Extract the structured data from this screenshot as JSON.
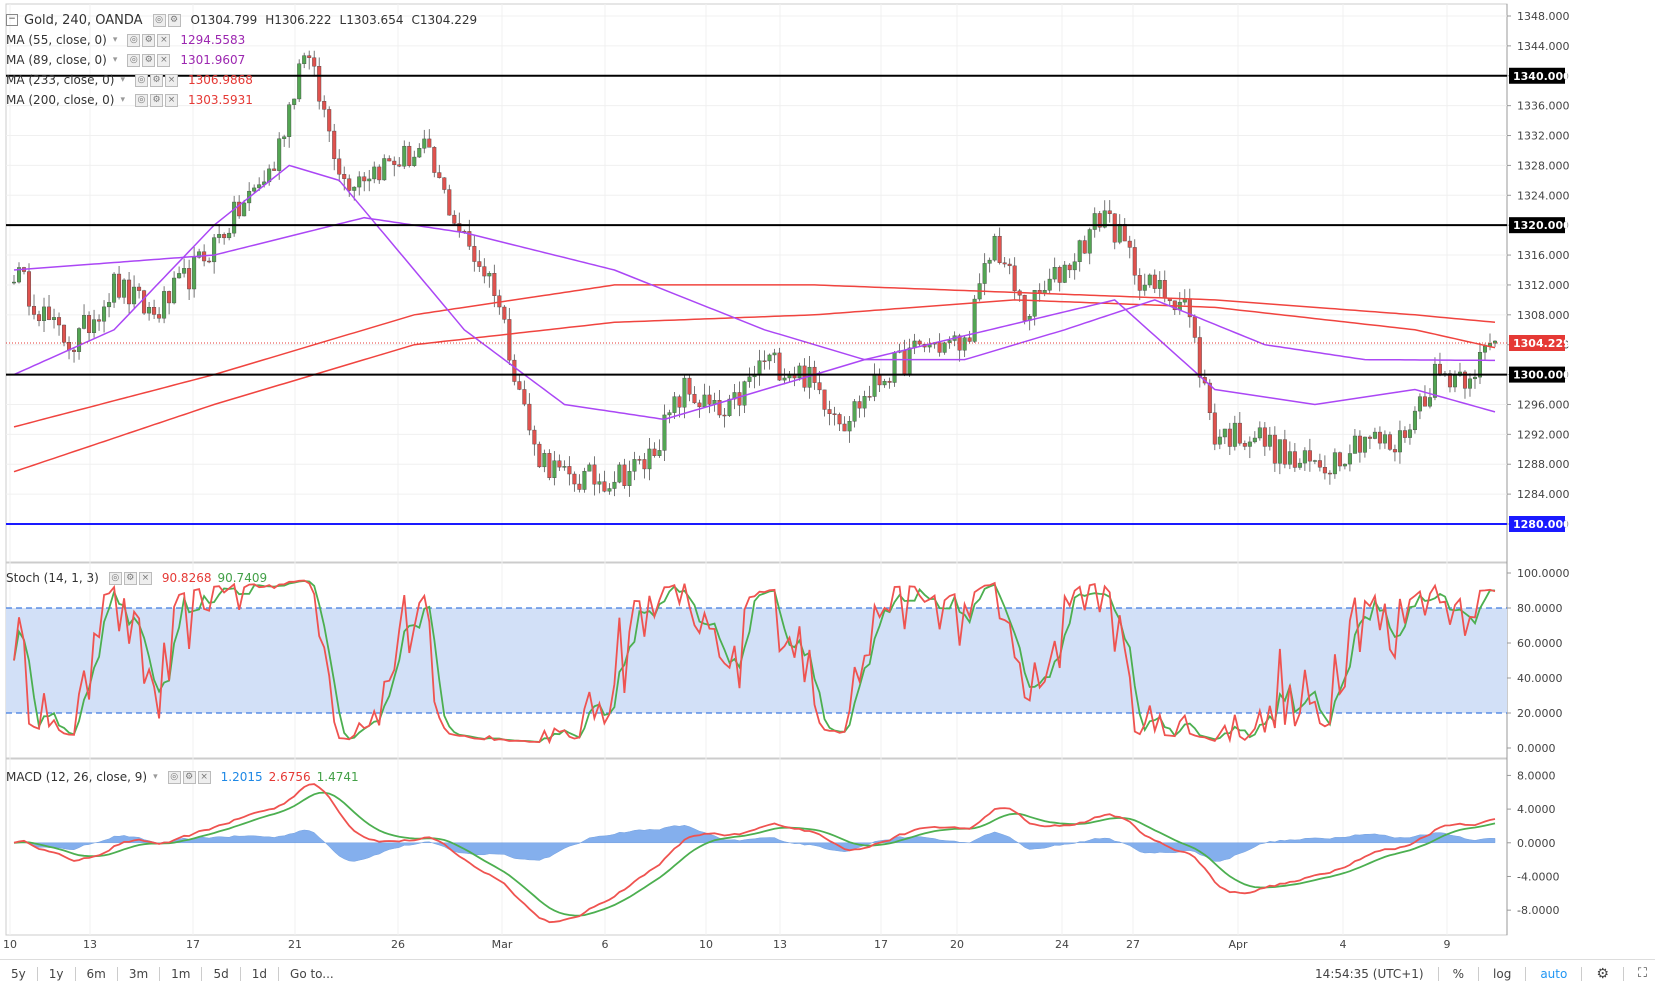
{
  "legend": {
    "symbol": "Gold, 240, OANDA",
    "ohlc": {
      "o": "O1304.799",
      "h": "H1306.222",
      "l": "L1303.654",
      "c": "C1304.229"
    },
    "mas": [
      {
        "label": "MA (55, close, 0)",
        "value": "1294.5583",
        "color": "#9c27b0"
      },
      {
        "label": "MA (89, close, 0)",
        "value": "1301.9607",
        "color": "#9c27b0"
      },
      {
        "label": "MA (233, close, 0)",
        "value": "1306.9868",
        "color": "#e53935"
      },
      {
        "label": "MA (200, close, 0)",
        "value": "1303.5931",
        "color": "#e53935"
      }
    ],
    "stoch": {
      "label": "Stoch (14, 1, 3)",
      "k": "90.8268",
      "d": "90.7409"
    },
    "macd": {
      "label": "MACD (12, 26, close, 9)",
      "hist": "1.2015",
      "macd": "2.6756",
      "signal": "1.4741"
    }
  },
  "bottombar": {
    "ranges": [
      "5y",
      "1y",
      "6m",
      "3m",
      "1m",
      "5d",
      "1d"
    ],
    "goto": "Go to...",
    "time": "14:54:35 (UTC+1)",
    "percent": "%",
    "log": "log",
    "auto": "auto",
    "gear": "gear-icon",
    "fullscreen": "fullscreen-icon"
  },
  "colors": {
    "up": "#53a653",
    "down": "#e0524e",
    "grid": "#f0f0f0",
    "ma_purple": "#ab47f5",
    "ma_red": "#f0443f",
    "stoch_k": "#ef5350",
    "stoch_d": "#4caf50",
    "band": "#d2e0f7",
    "macd_line": "#ef5350",
    "signal_line": "#4caf50",
    "hist": "#6fa2ea"
  },
  "chart_data": [
    {
      "type": "candlestick",
      "title": "Gold, 240, OANDA",
      "ylim": [
        1280,
        1348
      ],
      "y_ticks": [
        "1348.000",
        "1344.000",
        "1340.000",
        "1336.000",
        "1332.000",
        "1328.000",
        "1324.000",
        "1320.000",
        "1316.000",
        "1312.000",
        "1308.000",
        "1304.000",
        "1300.000",
        "1296.000",
        "1292.000",
        "1288.000",
        "1284.000",
        "1280.000"
      ],
      "x_ticks": [
        "10",
        "13",
        "17",
        "21",
        "26",
        "Mar",
        "6",
        "10",
        "13",
        "17",
        "20",
        "24",
        "27",
        "Apr",
        "4",
        "9"
      ],
      "hlines": [
        {
          "value": 1340,
          "label": "1340.000",
          "color": "#000000"
        },
        {
          "value": 1320,
          "label": "1320.000",
          "color": "#000000"
        },
        {
          "value": 1300,
          "label": "1300.000",
          "color": "#000000"
        },
        {
          "value": 1280,
          "label": "1280.000",
          "color": "#1a1aff"
        }
      ],
      "last_price": {
        "value": 1304.229,
        "label": "1304.229"
      },
      "anchors": [
        [
          0,
          1314
        ],
        [
          8,
          1306
        ],
        [
          12,
          1304
        ],
        [
          20,
          1312
        ],
        [
          28,
          1308
        ],
        [
          36,
          1314
        ],
        [
          45,
          1322
        ],
        [
          52,
          1328
        ],
        [
          58,
          1344
        ],
        [
          66,
          1326
        ],
        [
          74,
          1328
        ],
        [
          82,
          1330
        ],
        [
          90,
          1318
        ],
        [
          96,
          1312
        ],
        [
          104,
          1290
        ],
        [
          110,
          1286
        ],
        [
          118,
          1286
        ],
        [
          126,
          1288
        ],
        [
          134,
          1298
        ],
        [
          142,
          1294
        ],
        [
          150,
          1302
        ],
        [
          158,
          1300
        ],
        [
          166,
          1294
        ],
        [
          174,
          1300
        ],
        [
          182,
          1304
        ],
        [
          190,
          1304
        ],
        [
          196,
          1318
        ],
        [
          202,
          1308
        ],
        [
          212,
          1316
        ],
        [
          218,
          1322
        ],
        [
          226,
          1312
        ],
        [
          234,
          1310
        ],
        [
          240,
          1292
        ],
        [
          248,
          1292
        ],
        [
          256,
          1288
        ],
        [
          262,
          1288
        ],
        [
          270,
          1292
        ],
        [
          276,
          1290
        ],
        [
          284,
          1300
        ],
        [
          290,
          1300
        ],
        [
          296,
          1304
        ]
      ],
      "ma55": [
        [
          0,
          1300
        ],
        [
          20,
          1306
        ],
        [
          40,
          1320
        ],
        [
          55,
          1328
        ],
        [
          65,
          1326
        ],
        [
          90,
          1306
        ],
        [
          110,
          1296
        ],
        [
          130,
          1294
        ],
        [
          150,
          1298
        ],
        [
          170,
          1302
        ],
        [
          195,
          1306
        ],
        [
          220,
          1310
        ],
        [
          240,
          1298
        ],
        [
          260,
          1296
        ],
        [
          280,
          1298
        ],
        [
          296,
          1295
        ]
      ],
      "ma89": [
        [
          0,
          1314
        ],
        [
          40,
          1316
        ],
        [
          70,
          1321
        ],
        [
          90,
          1319
        ],
        [
          120,
          1314
        ],
        [
          150,
          1306
        ],
        [
          170,
          1302
        ],
        [
          190,
          1302
        ],
        [
          210,
          1306
        ],
        [
          228,
          1310
        ],
        [
          250,
          1304
        ],
        [
          270,
          1302
        ],
        [
          296,
          1301.9
        ]
      ],
      "ma233": [
        [
          0,
          1293
        ],
        [
          40,
          1300
        ],
        [
          80,
          1308
        ],
        [
          120,
          1312
        ],
        [
          160,
          1312
        ],
        [
          200,
          1311
        ],
        [
          240,
          1310
        ],
        [
          280,
          1308
        ],
        [
          296,
          1307
        ]
      ],
      "ma200": [
        [
          0,
          1287
        ],
        [
          40,
          1296
        ],
        [
          80,
          1304
        ],
        [
          120,
          1307
        ],
        [
          160,
          1308
        ],
        [
          200,
          1310
        ],
        [
          240,
          1309
        ],
        [
          280,
          1306
        ],
        [
          296,
          1303.6
        ]
      ]
    },
    {
      "type": "line",
      "title": "Stoch (14, 1, 3)",
      "ylim": [
        0,
        100
      ],
      "y_ticks": [
        "100.0000",
        "80.0000",
        "60.0000",
        "40.0000",
        "20.0000",
        "0.0000"
      ],
      "band": [
        20,
        80
      ],
      "series": [
        {
          "name": "%K",
          "color": "#ef5350"
        },
        {
          "name": "%D",
          "color": "#4caf50"
        }
      ]
    },
    {
      "type": "area",
      "title": "MACD (12, 26, close, 9)",
      "ylim": [
        -10,
        9
      ],
      "y_ticks": [
        "8.0000",
        "4.0000",
        "0.0000",
        "-4.0000",
        "-8.0000"
      ]
    }
  ]
}
